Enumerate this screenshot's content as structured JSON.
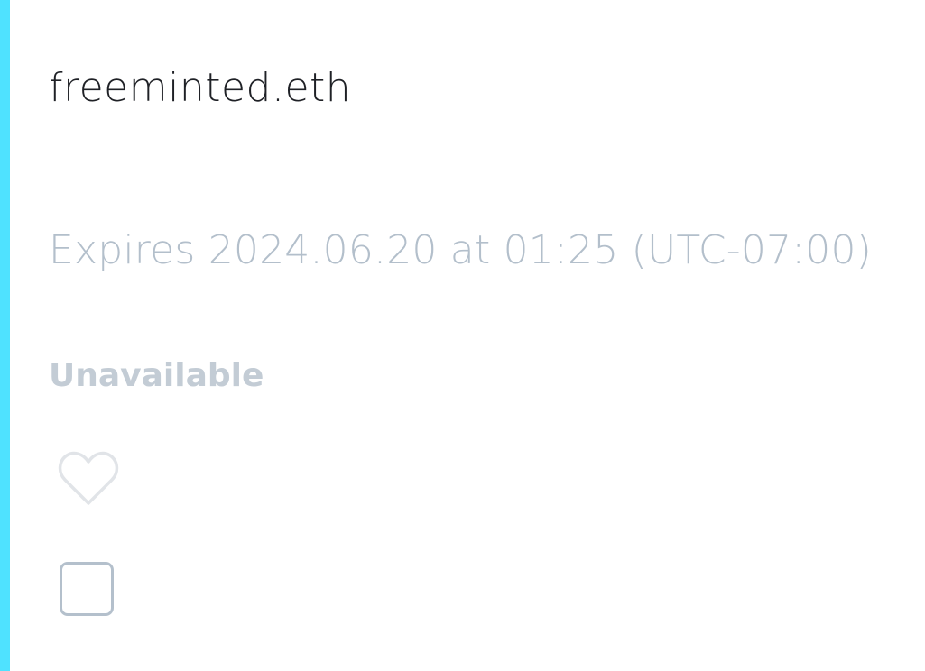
{
  "accent_color": "#4fe2ff",
  "domain": {
    "name": "freeminted.eth"
  },
  "expiry": {
    "text": "Expires 2024.06.20 at 01:25 (UTC-07:00)"
  },
  "status": {
    "label": "Unavailable"
  },
  "favorite": {
    "icon": "heart-outline-icon",
    "checked": false
  },
  "select": {
    "checked": false
  }
}
